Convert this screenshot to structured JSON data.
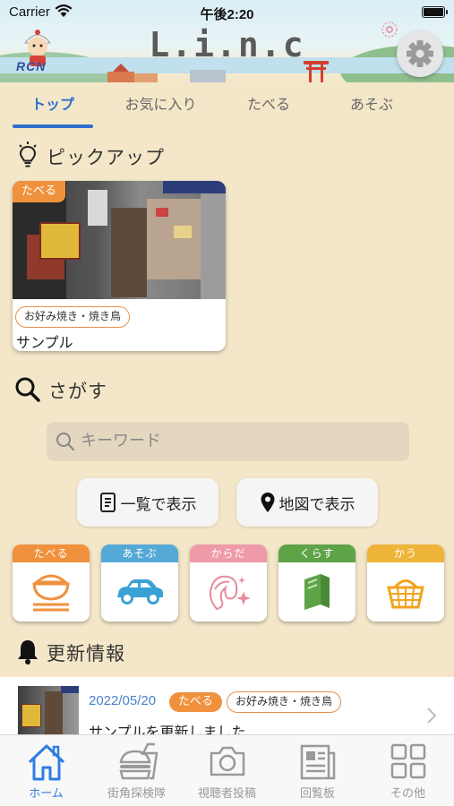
{
  "status_bar": {
    "carrier": "Carrier",
    "time": "午後2:20"
  },
  "header": {
    "logo": "L.i.n.c",
    "brand": "RCN",
    "settings_icon": "gear-icon"
  },
  "tabs": [
    {
      "label": "トップ",
      "active": true
    },
    {
      "label": "お気に入り",
      "active": false
    },
    {
      "label": "たべる",
      "active": false
    },
    {
      "label": "あそぶ",
      "active": false
    }
  ],
  "pickup": {
    "title": "ピックアップ",
    "icon": "lightbulb-icon",
    "card": {
      "category": "たべる",
      "tag": "お好み焼き・焼き鳥",
      "name": "サンプル"
    }
  },
  "search_section": {
    "title": "さがす",
    "placeholder": "キーワード",
    "list_button": "一覧で表示",
    "map_button": "地図で表示"
  },
  "categories": [
    {
      "label": "たべる",
      "color": "#f0913d",
      "icon": "rice-bowl-icon"
    },
    {
      "label": "あそぶ",
      "color": "#55a9d6",
      "icon": "car-icon"
    },
    {
      "label": "からだ",
      "color": "#ef9aa8",
      "icon": "hair-icon"
    },
    {
      "label": "くらす",
      "color": "#5ea348",
      "icon": "book-icon"
    },
    {
      "label": "かう",
      "color": "#efb43a",
      "icon": "basket-icon"
    }
  ],
  "updates": {
    "title": "更新情報",
    "icon": "bell-icon",
    "item": {
      "date": "2022/05/20",
      "category": "たべる",
      "tag": "お好み焼き・焼き鳥",
      "text": "サンプルを更新しました"
    }
  },
  "bottom_nav": [
    {
      "label": "ホーム",
      "icon": "home-icon",
      "active": true
    },
    {
      "label": "街角探検隊",
      "icon": "burger-icon",
      "active": false
    },
    {
      "label": "視聴者投稿",
      "icon": "camera-icon",
      "active": false
    },
    {
      "label": "回覧板",
      "icon": "newspaper-icon",
      "active": false
    },
    {
      "label": "その他",
      "icon": "grid-icon",
      "active": false
    }
  ],
  "colors": {
    "accent": "#2f6fcf",
    "background": "#f4e7c9",
    "food_orange": "#f0913d"
  }
}
